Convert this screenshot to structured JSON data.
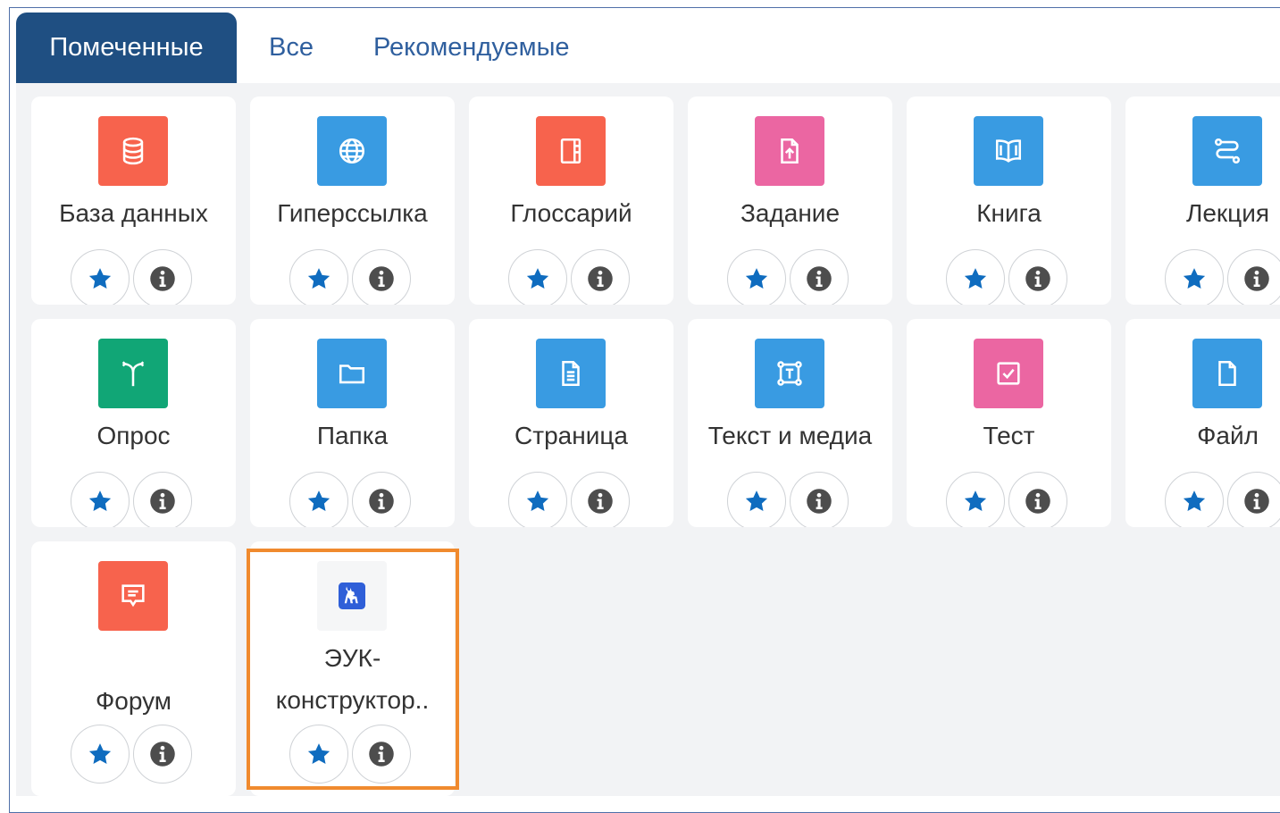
{
  "tabs": [
    {
      "label": "Помеченные",
      "active": true
    },
    {
      "label": "Все",
      "active": false
    },
    {
      "label": "Рекомендуемые",
      "active": false
    }
  ],
  "activities": [
    {
      "label": "База данных",
      "icon": "database-icon",
      "color": "#f7634d"
    },
    {
      "label": "Гиперссылка",
      "icon": "globe-icon",
      "color": "#399be2"
    },
    {
      "label": "Глоссарий",
      "icon": "glossary-book-icon",
      "color": "#f7634d"
    },
    {
      "label": "Задание",
      "icon": "file-upload-icon",
      "color": "#eb66a2"
    },
    {
      "label": "Книга",
      "icon": "open-book-icon",
      "color": "#399be2"
    },
    {
      "label": "Лекция",
      "icon": "lesson-path-icon",
      "color": "#399be2"
    },
    {
      "label": "Опрос",
      "icon": "signpost-icon",
      "color": "#11a676"
    },
    {
      "label": "Папка",
      "icon": "folder-icon",
      "color": "#399be2"
    },
    {
      "label": "Страница",
      "icon": "page-document-icon",
      "color": "#399be2"
    },
    {
      "label": "Текст и медиа",
      "icon": "text-frame-icon",
      "color": "#399be2"
    },
    {
      "label": "Тест",
      "icon": "checkbox-icon",
      "color": "#eb66a2"
    },
    {
      "label": "Файл",
      "icon": "file-icon",
      "color": "#399be2"
    },
    {
      "label": "Форум",
      "icon": "speech-bubble-icon",
      "color": "#f7634d"
    },
    {
      "label_line1": "ЭУК-",
      "label_line2": "конструктор..",
      "icon": "deer-logo-icon",
      "color": "#f5f6f7",
      "highlighted": true
    }
  ],
  "colors": {
    "primary": "#1f4f82",
    "star": "#0f6cbf",
    "info": "#4d4d4d",
    "highlight": "#f08a2e"
  }
}
